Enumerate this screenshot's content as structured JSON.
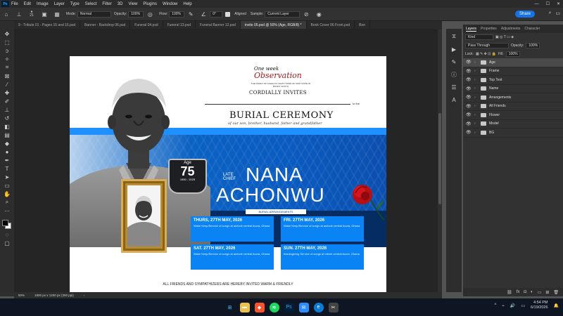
{
  "menu": {
    "app_logo": "Ps",
    "items": [
      "File",
      "Edit",
      "Image",
      "Layer",
      "Type",
      "Select",
      "Filter",
      "3D",
      "View",
      "Plugins",
      "Window",
      "Help"
    ],
    "window_controls": [
      "—",
      "☐",
      "✕"
    ]
  },
  "options": {
    "brush_size": "21",
    "mode_label": "Mode:",
    "mode_value": "Normal",
    "opacity_label": "Opacity:",
    "opacity_value": "100%",
    "flow_label": "Flow:",
    "flow_value": "100%",
    "angle_value": "0°",
    "aligned_label": "Aligned",
    "sample_label": "Sample:",
    "sample_value": "Current Layer",
    "share_label": "Share"
  },
  "tabs": [
    {
      "label": "9 - Tribute 01 - Pages 15 and 16.psd",
      "active": false
    },
    {
      "label": "Banner - Backdrop 06.psd",
      "active": false
    },
    {
      "label": "Funeral 04.psd",
      "active": false
    },
    {
      "label": "Funeral 13.psd",
      "active": false
    },
    {
      "label": "Funeral Banner 12.psd",
      "active": false
    },
    {
      "label": "invite 05.psd @ 50% (Age, RGB/8) *",
      "active": true
    },
    {
      "label": "Book Cover 06 Front.psd",
      "active": false
    },
    {
      "label": "Boo",
      "active": false
    }
  ],
  "document": {
    "one_week": "One week",
    "observation": "Observation",
    "family_line": "THE FAMILY OF ASHIA OF OSUTA TOWN OF KWO STATE IN BONNY SOUTH",
    "cordially": "CORDIALLY INVITES",
    "to_the": "to the",
    "burial_ceremony": "BURIAL CEREMONY",
    "our_son": "of our son, brother, husband, father and grandfather",
    "age_label": "Age",
    "age_number": "75",
    "age_years": "1950 - 2025",
    "late_chief": "LATE\nCHIEF",
    "first_name": "NANA",
    "last_name": "ACHONWU",
    "arrangements_label": "BURIAL ARRANGEMENTS",
    "events": [
      {
        "date": "THURS, 27TH MAY, 2026",
        "desc": "Wake Keep/Service of songs at ambole central Accra, Ghana"
      },
      {
        "date": "FRI. 27TH MAY, 2026",
        "desc": "Wake Keep/Service of songs at ambole central Accra, Ghana"
      },
      {
        "date": "SAT. 27TH MAY, 2026",
        "desc": "Wake Keep/Service of songs at ambole central Accra, Ghana"
      },
      {
        "date": "SUN. 27TH MAY, 2026",
        "desc": "thanksgiving Service of songs at mbole central Accra, Ghana"
      }
    ],
    "friends_line": "ALL FRIENDS AND SYMPATHIZERS ARE HEREBY INVITED WARM & FRIENDLY"
  },
  "layers_panel": {
    "tabs": [
      "Layers",
      "Properties",
      "Adjustments",
      "Character"
    ],
    "kind_label": "Kind",
    "blend_mode": "Pass Through",
    "opacity_label": "Opacity:",
    "opacity_value": "100%",
    "lock_label": "Lock:",
    "fill_label": "Fill:",
    "fill_value": "100%",
    "layers": [
      {
        "name": "Age",
        "selected": true
      },
      {
        "name": "Frame",
        "selected": false
      },
      {
        "name": "Top Text",
        "selected": false
      },
      {
        "name": "Name",
        "selected": false
      },
      {
        "name": "Arrangements",
        "selected": false
      },
      {
        "name": "All Friends",
        "selected": false
      },
      {
        "name": "Flower",
        "selected": false
      },
      {
        "name": "Model",
        "selected": false
      },
      {
        "name": "BG",
        "selected": false
      }
    ]
  },
  "status": {
    "zoom": "50%",
    "doc_size": "1800 px x 1200 px (300 ppi)"
  },
  "taskbar": {
    "time": "4:54 PM",
    "date": "6/19/2026"
  },
  "colors": {
    "share_blue": "#1473e6",
    "event_blue": "#0a84f5",
    "title_red": "#b1141a"
  }
}
